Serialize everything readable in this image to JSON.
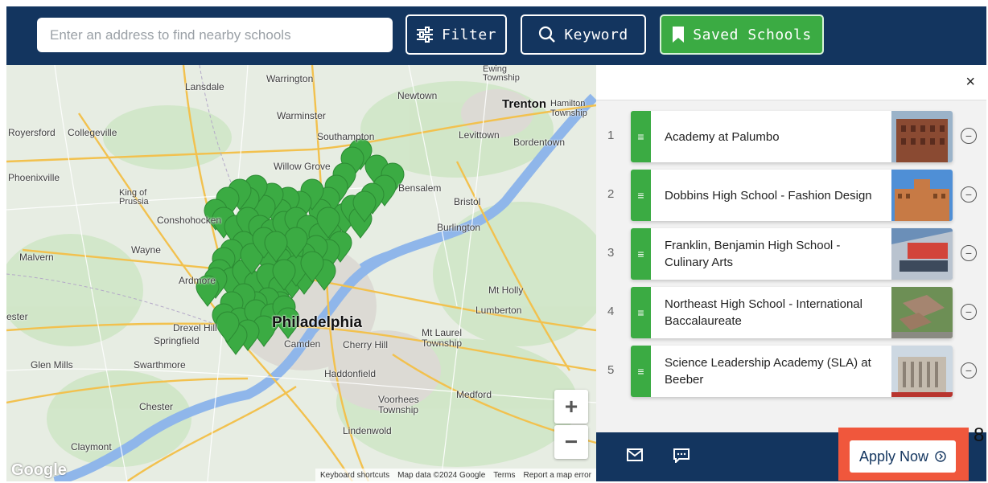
{
  "search": {
    "placeholder": "Enter an address to find nearby schools",
    "value": ""
  },
  "toolbar": {
    "filter_label": "Filter",
    "keyword_label": "Keyword",
    "saved_label": "Saved Schools"
  },
  "map": {
    "places": [
      {
        "id": "lansdale",
        "label": "Lansdale"
      },
      {
        "id": "warrington",
        "label": "Warrington"
      },
      {
        "id": "ewing",
        "label": "Ewing Township"
      },
      {
        "id": "newtown",
        "label": "Newtown"
      },
      {
        "id": "trenton",
        "label": "Trenton"
      },
      {
        "id": "hamilton",
        "label": "Hamilton Township"
      },
      {
        "id": "royersford",
        "label": "Royersford"
      },
      {
        "id": "collegeville",
        "label": "Collegeville"
      },
      {
        "id": "warminster",
        "label": "Warminster"
      },
      {
        "id": "southampton",
        "label": "Southampton"
      },
      {
        "id": "levittown",
        "label": "Levittown"
      },
      {
        "id": "bordentown",
        "label": "Bordentown"
      },
      {
        "id": "phoenixville",
        "label": "Phoenixville"
      },
      {
        "id": "willowgrove",
        "label": "Willow Grove"
      },
      {
        "id": "bensalem",
        "label": "Bensalem"
      },
      {
        "id": "kingofprussia",
        "label": "King of Prussia"
      },
      {
        "id": "conshohocken",
        "label": "Conshohocken"
      },
      {
        "id": "bristol",
        "label": "Bristol"
      },
      {
        "id": "burlington",
        "label": "Burlington"
      },
      {
        "id": "malvern",
        "label": "Malvern"
      },
      {
        "id": "wayne",
        "label": "Wayne"
      },
      {
        "id": "ardmore",
        "label": "Ardmore"
      },
      {
        "id": "mtholly",
        "label": "Mt Holly"
      },
      {
        "id": "lumberton",
        "label": "Lumberton"
      },
      {
        "id": "chester_w",
        "label": "ester"
      },
      {
        "id": "drexelhill",
        "label": "Drexel Hill"
      },
      {
        "id": "philadelphia",
        "label": "Philadelphia"
      },
      {
        "id": "springfield",
        "label": "Springfield"
      },
      {
        "id": "camden",
        "label": "Camden"
      },
      {
        "id": "cherryhill",
        "label": "Cherry Hill"
      },
      {
        "id": "mtlaurel",
        "label": "Mt Laurel Township"
      },
      {
        "id": "glenmills",
        "label": "Glen Mills"
      },
      {
        "id": "swarthmore",
        "label": "Swarthmore"
      },
      {
        "id": "haddonfield",
        "label": "Haddonfield"
      },
      {
        "id": "medford",
        "label": "Medford"
      },
      {
        "id": "voorhees",
        "label": "Voorhees Township"
      },
      {
        "id": "chester",
        "label": "Chester"
      },
      {
        "id": "lindenwold",
        "label": "Lindenwold"
      },
      {
        "id": "claymont",
        "label": "Claymont"
      }
    ],
    "zoom_in": "+",
    "zoom_out": "−",
    "google_logo": "Google",
    "footer": [
      "Keyboard shortcuts",
      "Map data ©2024 Google",
      "Terms",
      "Report a map error"
    ],
    "pin_color": "#3bab43"
  },
  "panel": {
    "close": "×",
    "schools": [
      {
        "rank": "1",
        "name": "Academy at Palumbo",
        "photo": "brick-building"
      },
      {
        "rank": "2",
        "name": "Dobbins High School - Fashion Design",
        "photo": "school-sky"
      },
      {
        "rank": "3",
        "name": "Franklin, Benjamin High School - Culinary Arts",
        "photo": "modern-facade"
      },
      {
        "rank": "4",
        "name": "Northeast High School - International Baccalaureate",
        "photo": "aerial-campus"
      },
      {
        "rank": "5",
        "name": "Science Leadership Academy (SLA) at Beeber",
        "photo": "columned-building"
      }
    ]
  },
  "bottom": {
    "apply_label": "Apply Now",
    "apply_icon": "arrow-circle-right-icon",
    "badge": "8"
  },
  "colors": {
    "navy": "#13355f",
    "green": "#3bab43",
    "highlight": "#f0573c"
  }
}
